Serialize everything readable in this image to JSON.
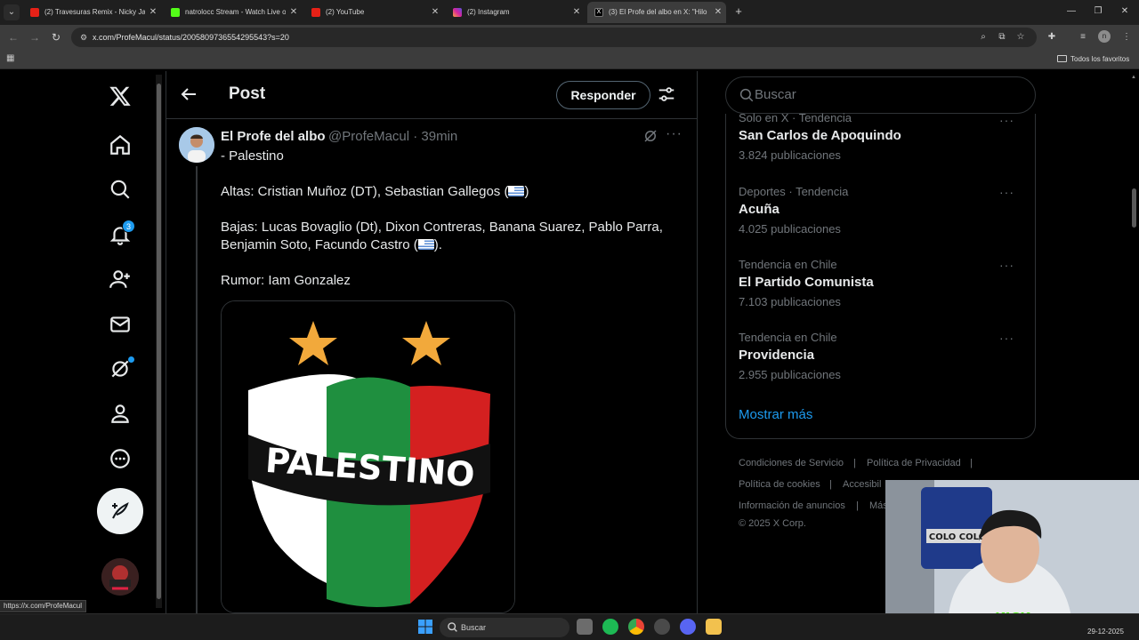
{
  "browser": {
    "tabs": [
      {
        "title": "(2) Travesuras Remix - Nicky Jam",
        "favicon_color": "#e62117"
      },
      {
        "title": "natrolocc Stream - Watch Live on",
        "favicon_color": "#53fc18"
      },
      {
        "title": "(2) YouTube",
        "favicon_color": "#e62117"
      },
      {
        "title": "(2) Instagram",
        "favicon_color": "#d6249f"
      },
      {
        "title": "(3) El Profe del albo en X: \"Hilo",
        "favicon_color": "#000000",
        "active": true
      }
    ],
    "url": "x.com/ProfeMacul/status/2005809736554295543?s=20",
    "profile_initial": "n",
    "bookmarks_folder": "Todos los favoritos",
    "status_url": "https://x.com/ProfeMacul"
  },
  "x_nav": {
    "notifications_badge": "3",
    "items": [
      "x-logo-icon",
      "home-icon",
      "explore-icon",
      "notifications-icon",
      "follow-icon",
      "messages-icon",
      "grok-icon",
      "profile-icon",
      "more-icon"
    ]
  },
  "header": {
    "title": "Post",
    "reply_label": "Responder"
  },
  "post": {
    "author_name": "El Profe del albo",
    "handle_time": "@ProfeMacul · 39min",
    "line1": "- Palestino",
    "altas": "Altas: Cristian Muñoz (DT), Sebastian Gallegos (",
    "altas_end": ")",
    "bajas1": "Bajas: Lucas Bovaglio (Dt), Dixon Contreras, Banana Suarez, Pablo Parra,",
    "bajas2": "Benjamin Soto, Facundo Castro (",
    "bajas2_end": ").",
    "rumor": "Rumor: Iam Gonzalez",
    "image_text": "PALESTINO"
  },
  "search": {
    "placeholder": "Buscar"
  },
  "trends": {
    "items": [
      {
        "category": "Solo en X · Tendencia",
        "name": "San Carlos de Apoquindo",
        "count": "3.824 publicaciones"
      },
      {
        "category": "Deportes · Tendencia",
        "name": "Acuña",
        "count": "4.025 publicaciones"
      },
      {
        "category": "Tendencia en Chile",
        "name": "El Partido Comunista",
        "count": "7.103 publicaciones"
      },
      {
        "category": "Tendencia en Chile",
        "name": "Providencia",
        "count": "2.955 publicaciones"
      }
    ],
    "show_more": "Mostrar más"
  },
  "footer": {
    "terms": "Condiciones de Servicio",
    "privacy": "Política de Privacidad",
    "cookies": "Política de cookies",
    "accessibility": "Accesibil",
    "ads": "Información de anuncios",
    "more": "Más",
    "copyright": "© 2025 X Corp."
  },
  "webcam": {
    "sign": "COLO COLO",
    "logo": "KICK",
    "logo_sub": "natrolocc"
  },
  "taskbar": {
    "search_label": "Buscar",
    "date": "29-12-2025"
  }
}
